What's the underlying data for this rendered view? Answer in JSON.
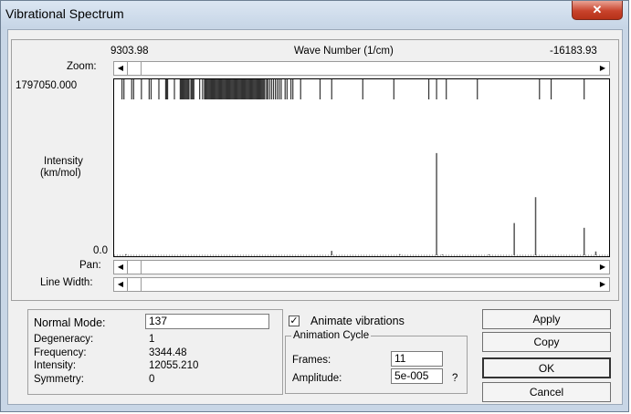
{
  "window": {
    "title": "Vibrational Spectrum",
    "close_glyph": "✕"
  },
  "axis": {
    "left_value": "9303.98",
    "title": "Wave Number (1/cm)",
    "right_value": "-16183.93",
    "y_max_label": "1797050.000",
    "y_min_label": "0.0",
    "y_title_line1": "Intensity",
    "y_title_line2": "(km/mol)"
  },
  "controls": {
    "zoom_label": "Zoom:",
    "pan_label": "Pan:",
    "linewidth_label": "Line Width:",
    "left_arrow": "◀",
    "right_arrow": "▶"
  },
  "info": {
    "normal_mode_label": "Normal Mode:",
    "normal_mode_value": "137",
    "degeneracy_label": "Degeneracy:",
    "degeneracy_value": "1",
    "frequency_label": "Frequency:",
    "frequency_value": "3344.48",
    "intensity_label": "Intensity:",
    "intensity_value": "12055.210",
    "symmetry_label": "Symmetry:",
    "symmetry_value": "0"
  },
  "animation": {
    "animate_label": "Animate vibrations",
    "animate_checked": true,
    "check_glyph": "✓",
    "group_label": "Animation Cycle",
    "frames_label": "Frames:",
    "frames_value": "11",
    "amplitude_label": "Amplitude:",
    "amplitude_value": "5e-005",
    "help_glyph": "?"
  },
  "buttons": {
    "apply": "Apply",
    "copy": "Copy",
    "ok": "OK",
    "cancel": "Cancel"
  },
  "colors": {
    "spectrum_line": "#555555",
    "dotted_axis": "#777777"
  },
  "chart_data": {
    "type": "bar",
    "xlabel": "Wave Number (1/cm)",
    "ylabel": "Intensity (km/mol)",
    "xlim": [
      9303.98,
      -16183.93
    ],
    "ylim": [
      0,
      1797050
    ],
    "grid": false,
    "tick_marks": [
      8900,
      8800,
      8400,
      8300,
      7900,
      7500,
      7400,
      7000,
      6650,
      6600,
      6550,
      6200,
      5900,
      5850,
      5800,
      5750,
      5700,
      5650,
      5600,
      5550,
      5500,
      5450,
      5350,
      5300,
      5250,
      5200,
      4900,
      4750,
      4650,
      4600,
      4550,
      4500,
      4450,
      4400,
      4350,
      4300,
      4250,
      4200,
      4150,
      4100,
      4050,
      4000,
      3950,
      3900,
      3850,
      3800,
      3750,
      3700,
      3650,
      3600,
      3550,
      3500,
      3450,
      3400,
      3350,
      3300,
      3250,
      3200,
      3150,
      3100,
      3050,
      3000,
      2950,
      2900,
      2850,
      2800,
      2750,
      2700,
      2650,
      2600,
      2550,
      2500,
      2450,
      2400,
      2350,
      2300,
      2250,
      2200,
      2150,
      2100,
      2050,
      2000,
      1950,
      1900,
      1850,
      1800,
      1750,
      1700,
      1650,
      1600,
      1550,
      1450,
      1400,
      1300,
      1200,
      1100,
      1000,
      900,
      800,
      700,
      500,
      400,
      200,
      100,
      -300,
      -1300,
      -1900,
      -3500,
      -5100,
      -6900,
      -7300,
      -7800,
      -9400,
      -12600,
      -13200,
      -14900
    ],
    "peaks": [
      {
        "x": 8700,
        "y": 12000
      },
      {
        "x": -1900,
        "y": 46000
      },
      {
        "x": -5400,
        "y": 12055
      },
      {
        "x": -7300,
        "y": 1055000
      },
      {
        "x": -7600,
        "y": 8000
      },
      {
        "x": -10000,
        "y": 9000
      },
      {
        "x": -11300,
        "y": 333000
      },
      {
        "x": -12400,
        "y": 600000
      },
      {
        "x": -14900,
        "y": 284000
      },
      {
        "x": -15500,
        "y": 40000
      }
    ]
  }
}
